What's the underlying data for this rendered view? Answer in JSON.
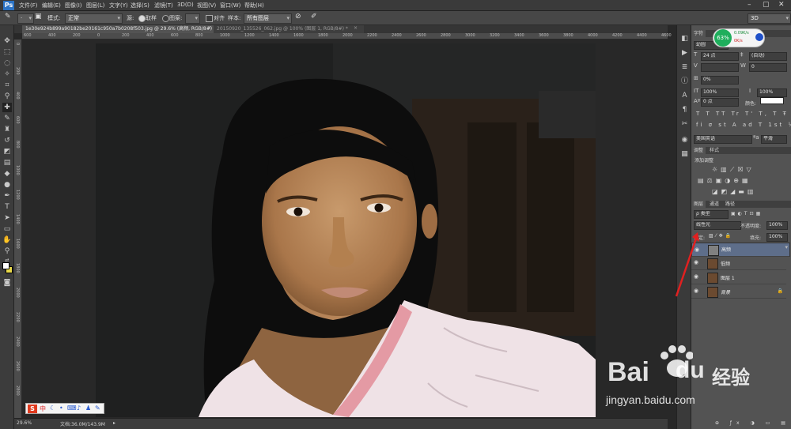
{
  "menubar": {
    "logo": "Ps",
    "items": [
      "文件(F)",
      "编辑(E)",
      "图像(I)",
      "图层(L)",
      "文字(Y)",
      "选择(S)",
      "滤镜(T)",
      "3D(D)",
      "视图(V)",
      "窗口(W)",
      "帮助(H)"
    ]
  },
  "options": {
    "mode_label": "模式:",
    "mode_value": "正常",
    "source_label": "源:",
    "sampled_label": "取样",
    "pattern_label": "图案:",
    "aligned_label": "对齐",
    "sample_label": "样本:",
    "sample_value": "所有图层",
    "workspace": "3D"
  },
  "tabs": [
    {
      "label": "1e30e924b899a90182be20161c950a7b0208f503.jpg @ 29.6% (高频, RGB/8#) *",
      "active": true
    },
    {
      "label": "20150920_135526_062.jpg @ 100% (图层 1, RGB/8#) *",
      "active": false
    }
  ],
  "ruler_ticks_h": [
    "600",
    "400",
    "200",
    "0",
    "200",
    "400",
    "600",
    "800",
    "1000",
    "1200",
    "1400",
    "1600",
    "1800",
    "2000",
    "2200",
    "2400",
    "2600",
    "2800",
    "3000",
    "3200",
    "3400",
    "3600",
    "3800",
    "4000",
    "4200",
    "4400",
    "4600"
  ],
  "ruler_ticks_v": [
    "0",
    "200",
    "400",
    "600",
    "800",
    "1000",
    "1200",
    "1400",
    "1600",
    "1800",
    "2000",
    "2200",
    "2400",
    "2600",
    "2800"
  ],
  "status": {
    "zoom": "29.6%",
    "doc": "文档:36.0M/143.9M"
  },
  "ime": {
    "label": "中"
  },
  "widget": {
    "percent": "63%",
    "up": "0.09K/s",
    "down": "0K/s"
  },
  "character_panel": {
    "tab": "字符",
    "font_size": "24 点",
    "leading": "(自动)",
    "tracking": "0",
    "scale_pct": "0%",
    "vscale": "100%",
    "hscale": "100%",
    "baseline": "0 点",
    "color_label": "颜色:",
    "language": "美国英语",
    "aa": "平滑",
    "font": "幼圆"
  },
  "adjustments_panel": {
    "tabs": [
      "调整",
      "样式"
    ],
    "title": "添加调整"
  },
  "layers_panel": {
    "tabs": [
      "图层",
      "通道",
      "路径"
    ],
    "kind": "ρ 类型",
    "blend": "线性光",
    "opacity_label": "不透明度:",
    "opacity": "100%",
    "lock_label": "锁定:",
    "fill_label": "填充:",
    "fill": "100%",
    "layers": [
      {
        "name": "高频",
        "selected": true,
        "thumb": "gray"
      },
      {
        "name": "低频",
        "selected": false,
        "thumb": "face"
      },
      {
        "name": "图层 1",
        "selected": false,
        "thumb": "face"
      },
      {
        "name": "背景",
        "selected": false,
        "thumb": "face",
        "locked": true
      }
    ]
  },
  "watermark": {
    "brand": "Bai",
    "brand2": "du",
    "product": "经验",
    "url": "jingyan.baidu.com"
  },
  "colors": {
    "accent": "#2c73c4",
    "selected_layer": "#5e6e8a",
    "arrow": "#e02020",
    "foreground": "#ffffff",
    "background": "#e8d94a"
  }
}
